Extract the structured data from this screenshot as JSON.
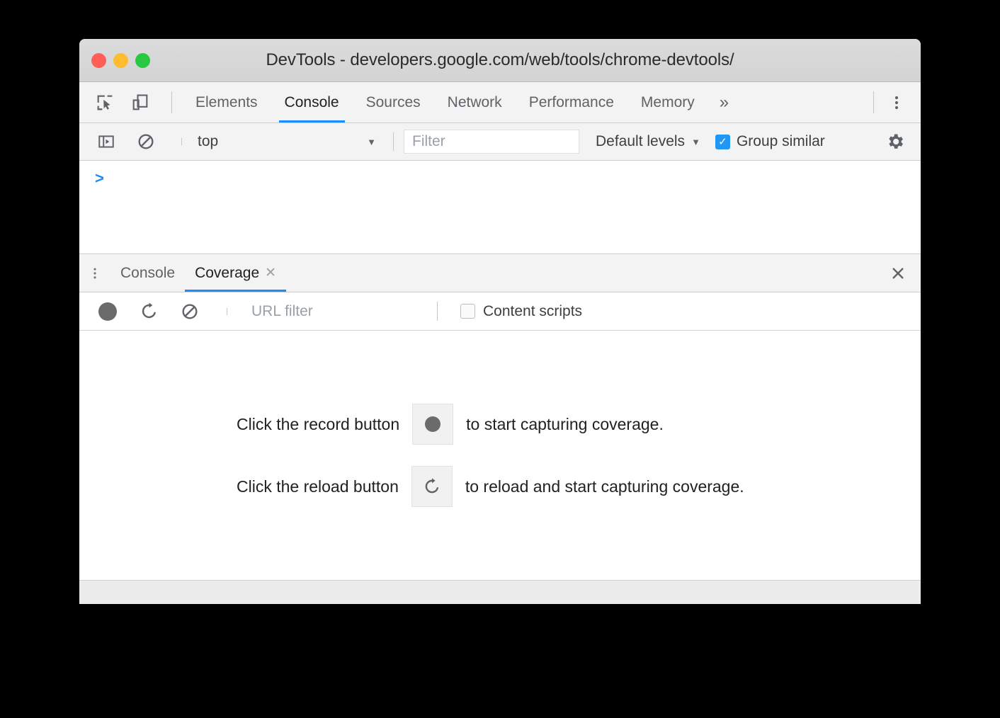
{
  "window": {
    "title": "DevTools - developers.google.com/web/tools/chrome-devtools/",
    "traffic_lights": [
      {
        "name": "close",
        "color": "#ff5f57"
      },
      {
        "name": "minimize",
        "color": "#febc2e"
      },
      {
        "name": "zoom",
        "color": "#28c840"
      }
    ]
  },
  "main_toolbar": {
    "inspect_icon": "inspect-element-icon",
    "device_icon": "device-toolbar-icon",
    "menu_icon": "vertical-dots-icon",
    "tabs": [
      {
        "label": "Elements",
        "active": false
      },
      {
        "label": "Console",
        "active": true
      },
      {
        "label": "Sources",
        "active": false
      },
      {
        "label": "Network",
        "active": false
      },
      {
        "label": "Performance",
        "active": false
      },
      {
        "label": "Memory",
        "active": false
      }
    ],
    "more_tabs_label": "»",
    "active_tab_underline_color": "#1a8cff"
  },
  "console_toolbar": {
    "sidebar_toggle_icon": "console-sidebar-toggle-icon",
    "clear_icon": "clear-console-icon",
    "context_value": "top",
    "context_caret": "▼",
    "filter_placeholder": "Filter",
    "levels_label": "Default levels",
    "levels_caret": "▼",
    "group_similar_label": "Group similar",
    "group_similar_checked": true,
    "checkbox_color": "#2196f3",
    "settings_icon": "gear-icon"
  },
  "console_output": {
    "prompt": ">",
    "prompt_color": "#1a8cff"
  },
  "drawer": {
    "menu_icon": "vertical-dots-icon",
    "tabs": [
      {
        "label": "Console",
        "active": false,
        "closable": false
      },
      {
        "label": "Coverage",
        "active": true,
        "closable": true,
        "close_glyph": "✕"
      }
    ],
    "close_glyph": "✕",
    "active_tab_underline_color": "#1a8cff"
  },
  "coverage_toolbar": {
    "record_icon": "record-icon",
    "reload_icon": "reload-icon",
    "clear_icon": "clear-icon",
    "url_filter_placeholder": "URL filter",
    "content_scripts_label": "Content scripts",
    "content_scripts_checked": false
  },
  "coverage_body": {
    "hints": [
      {
        "text_before": "Click the record button",
        "button_icon": "record-icon",
        "text_after": "to start capturing coverage."
      },
      {
        "text_before": "Click the reload button",
        "button_icon": "reload-icon",
        "text_after": "to reload and start capturing coverage."
      }
    ]
  }
}
